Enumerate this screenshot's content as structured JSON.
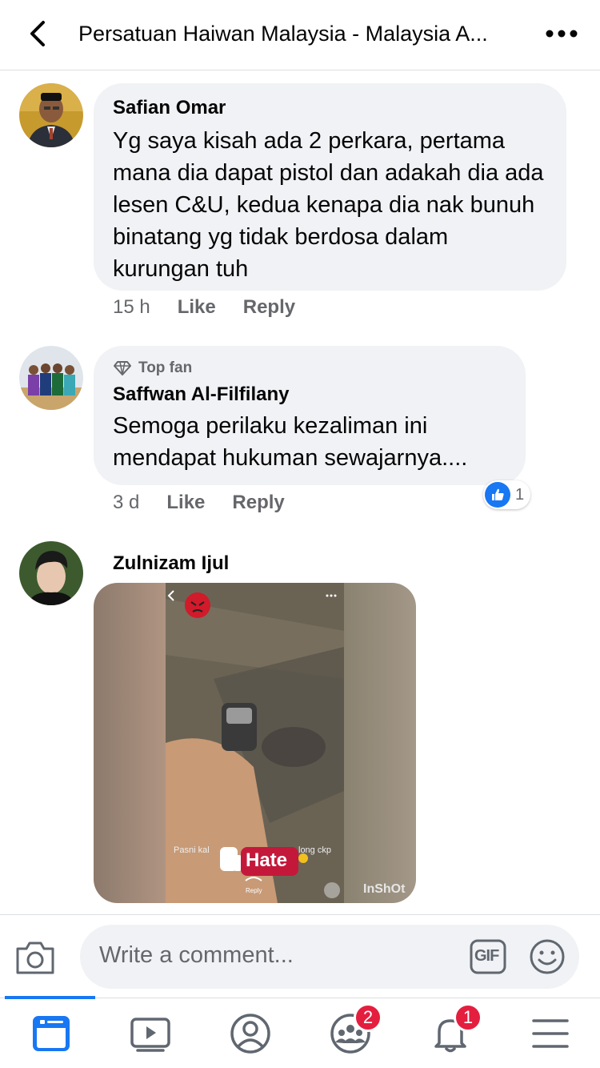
{
  "header": {
    "title": "Persatuan Haiwan Malaysia - Malaysia A...",
    "back_icon": "chevron-left-icon",
    "more_icon": "ellipsis-icon"
  },
  "comments": [
    {
      "author": "Safian Omar",
      "text": "Yg saya kisah ada 2 perkara, pertama mana dia dapat pistol dan adakah dia ada lesen C&U, kedua kenapa dia nak bunuh binatang yg tidak berdosa dalam kurungan tuh",
      "time": "15 h",
      "like_label": "Like",
      "reply_label": "Reply"
    },
    {
      "badge": "Top fan",
      "author": "Saffwan Al-Filfilany",
      "text": "Semoga perilaku kezaliman ini mendapat hukuman sewajarnya....",
      "time": "3 d",
      "like_label": "Like",
      "reply_label": "Reply",
      "reaction_count": "1"
    },
    {
      "author": "Zulnizam Ijul",
      "media": {
        "video_caption_left": "Pasni kal",
        "video_caption_right": "long ckp",
        "sticker_text": "Hate",
        "reply_label": "Reply",
        "watermark": "InShOt"
      }
    }
  ],
  "composer": {
    "placeholder": "Write a comment...",
    "gif_label": "GIF"
  },
  "nav": {
    "items": [
      {
        "icon": "news-feed-icon",
        "active": true
      },
      {
        "icon": "watch-icon"
      },
      {
        "icon": "profile-icon"
      },
      {
        "icon": "groups-icon",
        "badge": "2"
      },
      {
        "icon": "notifications-icon",
        "badge": "1"
      },
      {
        "icon": "menu-icon"
      }
    ]
  },
  "colors": {
    "accent": "#1877f2",
    "bubble": "#f0f2f5",
    "secondary_text": "#65676b",
    "badge": "#e41e3f"
  }
}
